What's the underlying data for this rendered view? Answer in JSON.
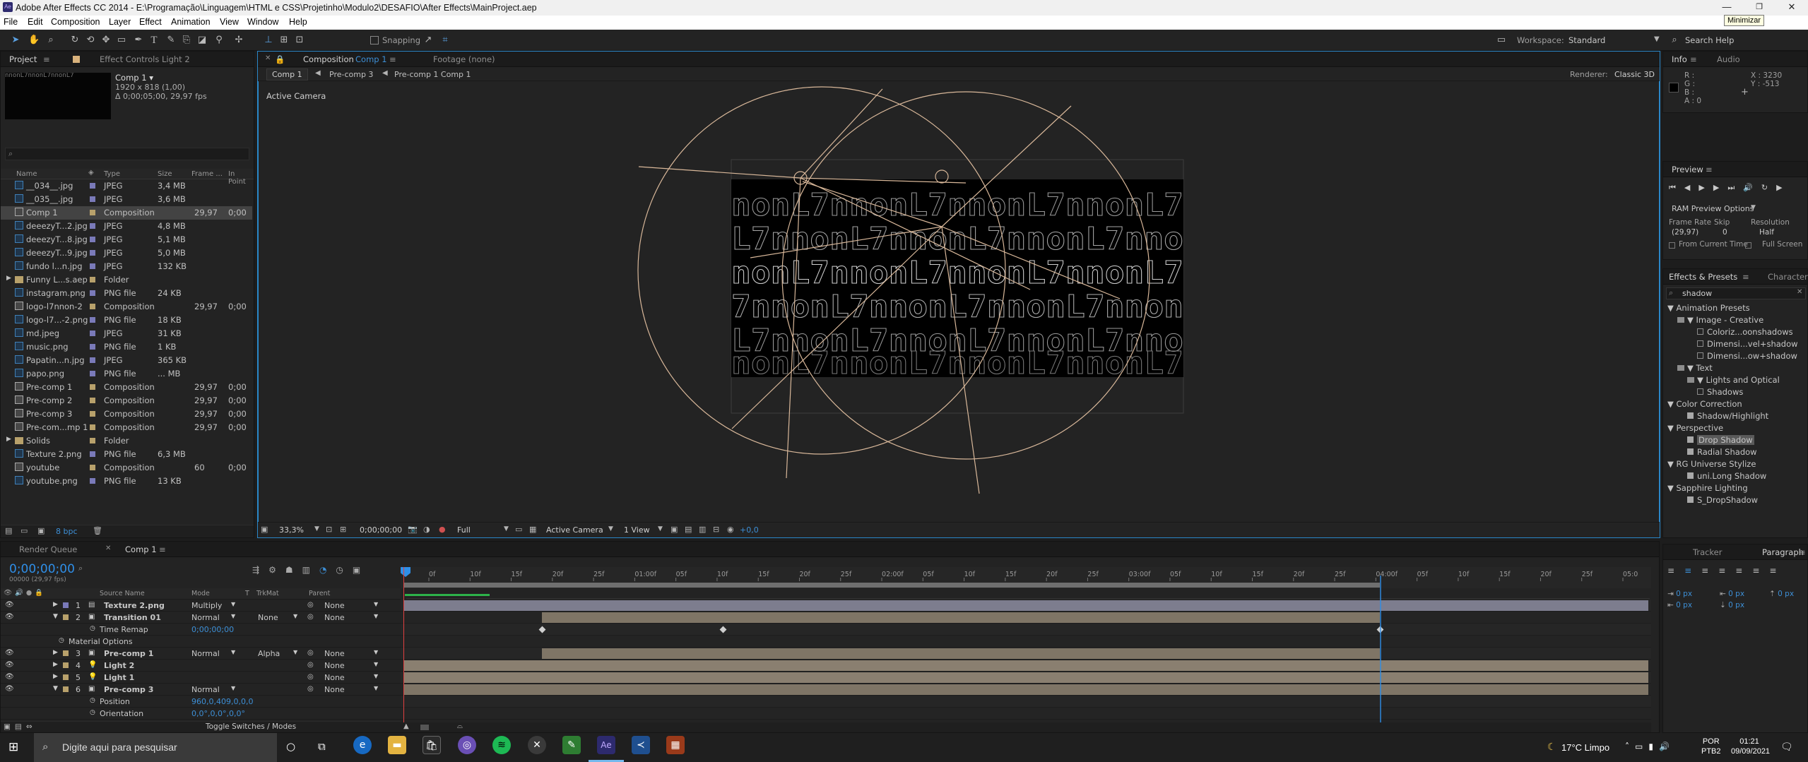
{
  "app": {
    "title": "Adobe After Effects CC 2014 - E:\\Programação\\Linguagem\\HTML e CSS\\Projetinho\\Modulo2\\DESAFIO\\After Effects\\MainProject.aep",
    "logo": "Ae",
    "minimize_tooltip": "Minimizar"
  },
  "menu": [
    "File",
    "Edit",
    "Composition",
    "Layer",
    "Effect",
    "Animation",
    "View",
    "Window",
    "Help"
  ],
  "toolbar": {
    "snapping": "Snapping",
    "workspace_label": "Workspace:",
    "workspace_value": "Standard",
    "search_help": "Search Help"
  },
  "project": {
    "tab": "Project",
    "effect_controls_tab": "Effect Controls Light 2",
    "comp_name": "Comp 1 ▾",
    "comp_size": "1920 x 818 (1,00)",
    "comp_duration": "Δ 0;00;05;00, 29,97 fps",
    "columns": [
      "Name",
      "Type",
      "Size",
      "Frame ...",
      "In Point"
    ],
    "items": [
      {
        "name": "__034__.jpg",
        "type": "JPEG",
        "size": "3,4 MB",
        "fps": "",
        "in": "",
        "label": "#7a7ab9",
        "icon": "file"
      },
      {
        "name": "__035__.jpg",
        "type": "JPEG",
        "size": "3,6 MB",
        "fps": "",
        "in": "",
        "label": "#7a7ab9",
        "icon": "file"
      },
      {
        "name": "Comp 1",
        "type": "Composition",
        "size": "",
        "fps": "29,97",
        "in": "0;00",
        "label": "#b8a16b",
        "icon": "comp",
        "selected": true
      },
      {
        "name": "deeezyT...2.jpg",
        "type": "JPEG",
        "size": "4,8 MB",
        "fps": "",
        "in": "",
        "label": "#7a7ab9",
        "icon": "file"
      },
      {
        "name": "deeezyT...8.jpg",
        "type": "JPEG",
        "size": "5,1 MB",
        "fps": "",
        "in": "",
        "label": "#7a7ab9",
        "icon": "file"
      },
      {
        "name": "deeezyT...9.jpg",
        "type": "JPEG",
        "size": "5,0 MB",
        "fps": "",
        "in": "",
        "label": "#7a7ab9",
        "icon": "file"
      },
      {
        "name": "fundo l...n.jpg",
        "type": "JPEG",
        "size": "132 KB",
        "fps": "",
        "in": "",
        "label": "#7a7ab9",
        "icon": "file"
      },
      {
        "name": "Funny L...s.aep",
        "type": "Folder",
        "size": "",
        "fps": "",
        "in": "",
        "label": "#b8a16b",
        "icon": "folder"
      },
      {
        "name": "instagram.png",
        "type": "PNG file",
        "size": "24 KB",
        "fps": "",
        "in": "",
        "label": "#7a7ab9",
        "icon": "file"
      },
      {
        "name": "logo-l7nnon-2",
        "type": "Composition",
        "size": "",
        "fps": "29,97",
        "in": "0;00",
        "label": "#b8a16b",
        "icon": "comp"
      },
      {
        "name": "logo-l7...-2.png",
        "type": "PNG file",
        "size": "18 KB",
        "fps": "",
        "in": "",
        "label": "#7a7ab9",
        "icon": "file"
      },
      {
        "name": "md.jpeg",
        "type": "JPEG",
        "size": "31 KB",
        "fps": "",
        "in": "",
        "label": "#7a7ab9",
        "icon": "file"
      },
      {
        "name": "music.png",
        "type": "PNG file",
        "size": "1 KB",
        "fps": "",
        "in": "",
        "label": "#7a7ab9",
        "icon": "file"
      },
      {
        "name": "Papatin...n.jpg",
        "type": "JPEG",
        "size": "365 KB",
        "fps": "",
        "in": "",
        "label": "#7a7ab9",
        "icon": "file"
      },
      {
        "name": "papo.png",
        "type": "PNG file",
        "size": "... MB",
        "fps": "",
        "in": "",
        "label": "#7a7ab9",
        "icon": "file"
      },
      {
        "name": "Pre-comp 1",
        "type": "Composition",
        "size": "",
        "fps": "29,97",
        "in": "0;00",
        "label": "#b8a16b",
        "icon": "comp"
      },
      {
        "name": "Pre-comp 2",
        "type": "Composition",
        "size": "",
        "fps": "29,97",
        "in": "0;00",
        "label": "#b8a16b",
        "icon": "comp"
      },
      {
        "name": "Pre-comp 3",
        "type": "Composition",
        "size": "",
        "fps": "29,97",
        "in": "0;00",
        "label": "#b8a16b",
        "icon": "comp"
      },
      {
        "name": "Pre-com...mp 1",
        "type": "Composition",
        "size": "",
        "fps": "29,97",
        "in": "0;00",
        "label": "#b8a16b",
        "icon": "comp"
      },
      {
        "name": "Solids",
        "type": "Folder",
        "size": "",
        "fps": "",
        "in": "",
        "label": "#b8a16b",
        "icon": "folder"
      },
      {
        "name": "Texture 2.png",
        "type": "PNG file",
        "size": "6,3 MB",
        "fps": "",
        "in": "",
        "label": "#7a7ab9",
        "icon": "file"
      },
      {
        "name": "youtube",
        "type": "Composition",
        "size": "",
        "fps": "60",
        "in": "0;00",
        "label": "#b8a16b",
        "icon": "comp"
      },
      {
        "name": "youtube.png",
        "type": "PNG file",
        "size": "13 KB",
        "fps": "",
        "in": "",
        "label": "#7a7ab9",
        "icon": "file"
      }
    ],
    "bpc": "8 bpc"
  },
  "composition": {
    "tab": "Composition",
    "tab_comp": "Comp 1",
    "footage_tab": "Footage (none)",
    "breadcrumbs": [
      "Comp 1",
      "Pre-comp 3",
      "Pre-comp 1 Comp 1"
    ],
    "renderer_label": "Renderer:",
    "renderer": "Classic 3D",
    "active_camera": "Active Camera",
    "bottom": {
      "zoom": "33,3%",
      "time": "0;00;00;00",
      "quality": "Full",
      "view": "Active Camera",
      "views": "1 View",
      "exposure": "+0,0"
    },
    "art_text": "nnonL7nnonL7nnonL7"
  },
  "info": {
    "tab": "Info",
    "audio_tab": "Audio",
    "r": "R :",
    "g": "G :",
    "b": "B :",
    "a": "A : 0",
    "x": "X : 3230",
    "y": "Y : -513"
  },
  "preview": {
    "tab": "Preview",
    "ram": "RAM Preview Options",
    "frame_rate_label": "Frame Rate",
    "skip_label": "Skip",
    "resolution_label": "Resolution",
    "frame_rate": "(29,97)",
    "skip": "0",
    "resolution": "Half",
    "from_current": "From Current Time",
    "full_screen": "Full Screen"
  },
  "effects": {
    "tab": "Effects & Presets",
    "character_tab": "Character",
    "search": "shadow",
    "tree": [
      {
        "t": "▼ Animation Presets",
        "lvl": 0,
        "kind": "cat"
      },
      {
        "t": "▼ Image - Creative",
        "lvl": 1,
        "kind": "folder"
      },
      {
        "t": "Coloriz...oonshadows",
        "lvl": 3,
        "kind": "preset"
      },
      {
        "t": "Dimensi...vel+shadow",
        "lvl": 3,
        "kind": "preset"
      },
      {
        "t": "Dimensi...ow+shadow",
        "lvl": 3,
        "kind": "preset"
      },
      {
        "t": "▼ Text",
        "lvl": 1,
        "kind": "folder"
      },
      {
        "t": "▼ Lights and Optical",
        "lvl": 2,
        "kind": "folder"
      },
      {
        "t": "Shadows",
        "lvl": 3,
        "kind": "preset"
      },
      {
        "t": "▼ Color Correction",
        "lvl": 0,
        "kind": "cat"
      },
      {
        "t": "Shadow/Highlight",
        "lvl": 2,
        "kind": "fx"
      },
      {
        "t": "▼ Perspective",
        "lvl": 0,
        "kind": "cat"
      },
      {
        "t": "Drop Shadow",
        "lvl": 2,
        "kind": "fx",
        "selected": true
      },
      {
        "t": "Radial Shadow",
        "lvl": 2,
        "kind": "fx"
      },
      {
        "t": "▼ RG Universe Stylize",
        "lvl": 0,
        "kind": "cat"
      },
      {
        "t": "uni.Long Shadow",
        "lvl": 2,
        "kind": "fx"
      },
      {
        "t": "▼ Sapphire Lighting",
        "lvl": 0,
        "kind": "cat"
      },
      {
        "t": "S_DropShadow",
        "lvl": 2,
        "kind": "fx"
      }
    ]
  },
  "tracker": {
    "tab": "Tracker",
    "paragraph_tab": "Paragraph",
    "px": "0 px"
  },
  "timeline": {
    "render_tab": "Render Queue",
    "comp_tab": "Comp 1",
    "timecode": "0;00;00;00",
    "fps_info": "00000 (29,97 fps)",
    "columns": {
      "source": "Source Name",
      "mode": "Mode",
      "t": "T",
      "trkmat": "TrkMat",
      "parent": "Parent"
    },
    "toggle": "Toggle Switches / Modes",
    "ruler": [
      "0f",
      "10f",
      "15f",
      "20f",
      "25f",
      "01:00f",
      "05f",
      "10f",
      "15f",
      "20f",
      "25f",
      "02:00f",
      "05f",
      "10f",
      "15f",
      "20f",
      "25f",
      "03:00f",
      "05f",
      "10f",
      "15f",
      "20f",
      "25f",
      "04:00f",
      "05f",
      "10f",
      "15f",
      "20f",
      "25f",
      "05:0"
    ],
    "layers": [
      {
        "num": "1",
        "name": "Texture 2.png",
        "mode": "Multiply",
        "trkmat": "",
        "parent": "None",
        "kind": "file",
        "label": "#7a7ab9"
      },
      {
        "num": "2",
        "name": "Transition 01",
        "mode": "Normal",
        "trkmat": "None",
        "parent": "None",
        "kind": "comp",
        "label": "#b8a16b",
        "expanded": true
      },
      {
        "prop": "Time Remap",
        "value": "0;00;00;00"
      },
      {
        "prop": "Material Options",
        "value": ""
      },
      {
        "num": "3",
        "name": "Pre-comp 1",
        "mode": "Normal",
        "trkmat": "Alpha",
        "parent": "None",
        "kind": "comp",
        "label": "#b8a16b"
      },
      {
        "num": "4",
        "name": "Light 2",
        "mode": "",
        "trkmat": "",
        "parent": "None",
        "kind": "light",
        "label": "#b8a16b"
      },
      {
        "num": "5",
        "name": "Light 1",
        "mode": "",
        "trkmat": "",
        "parent": "None",
        "kind": "light",
        "label": "#b8a16b"
      },
      {
        "num": "6",
        "name": "Pre-comp 3",
        "mode": "Normal",
        "trkmat": "",
        "parent": "None",
        "kind": "comp",
        "label": "#b8a16b",
        "expanded": true
      },
      {
        "prop": "Position",
        "value": "960,0,409,0,0,0"
      },
      {
        "prop": "Orientation",
        "value": "0,0°,0,0°,0,0°"
      }
    ]
  },
  "taskbar": {
    "search": "Digite aqui para pesquisar",
    "weather": "17°C Limpo",
    "lang1": "POR",
    "lang2": "PTB2",
    "time": "01:21",
    "date": "09/09/2021"
  },
  "colors": {
    "panel": "#232323",
    "accent": "#2a87c8",
    "timecode": "#2f8fe8",
    "wire": "#d9b89a"
  }
}
